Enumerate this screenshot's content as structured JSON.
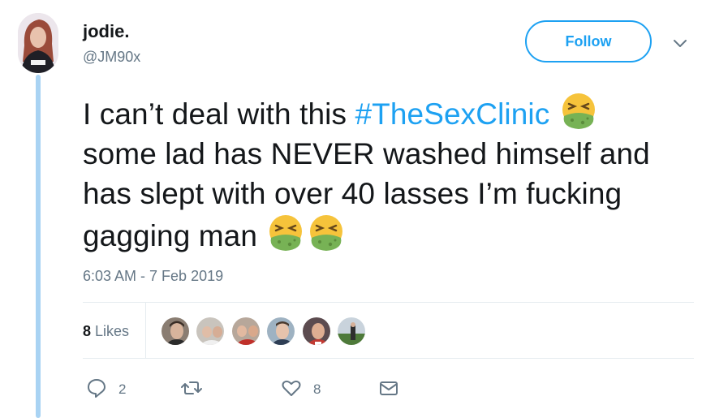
{
  "user": {
    "name": "jodie.",
    "handle": "@JM90x"
  },
  "follow_label": "Follow",
  "tweet": {
    "line1_pre": "I can’t deal with this ",
    "hashtag": "#TheSexClinic",
    "line2": "some lad has NEVER washed himself and",
    "line3": "has slept with over 40 lasses I’m fucking",
    "line4": "gagging man",
    "emoji": "nauseated-face"
  },
  "timestamp": "6:03 AM - 7 Feb 2019",
  "stats": {
    "likes_count": "8",
    "likes_label": "Likes"
  },
  "actions": {
    "replies": "2",
    "likes": "8"
  },
  "colors": {
    "accent": "#1da1f2",
    "thread_line": "#a9d3f3",
    "muted": "#657786"
  }
}
